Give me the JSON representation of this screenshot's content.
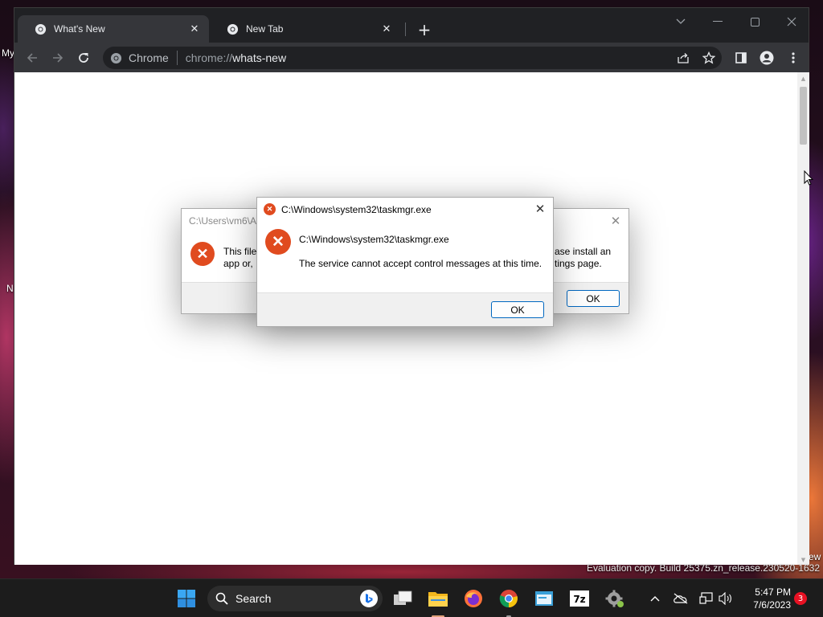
{
  "desktop": {
    "labels": [
      "My",
      "N",
      "ew"
    ]
  },
  "browser": {
    "tabs": [
      {
        "title": "What's New",
        "active": true
      },
      {
        "title": "New Tab",
        "active": false
      }
    ],
    "omnibox": {
      "chip": "Chrome",
      "scheme": "chrome://",
      "host": "whats-new"
    }
  },
  "dialog_back": {
    "title": "C:\\Users\\vm6\\A",
    "message_left": "This file",
    "message_left_2": "app or,",
    "message_right": "ase install an",
    "message_right_2": "tings page.",
    "ok_label": "OK"
  },
  "dialog_front": {
    "title": "C:\\Windows\\system32\\taskmgr.exe",
    "heading": "C:\\Windows\\system32\\taskmgr.exe",
    "message": "The service cannot accept control messages at this time.",
    "ok_label": "OK"
  },
  "taskbar": {
    "search_label": "Search",
    "time": "5:47 PM",
    "date": "7/6/2023",
    "notification_count": "3",
    "apps": [
      "start-icon",
      "search",
      "bing-icon",
      "task-view-icon",
      "file-explorer-icon",
      "firefox-icon",
      "chrome-icon",
      "app-icon",
      "7zip-icon",
      "settings-icon"
    ]
  },
  "watermark": "Evaluation copy. Build 25375.zn_release.230520-1632",
  "colors": {
    "error_red": "#e04b1f",
    "button_accent": "#0067c0",
    "browser_frame": "#202124",
    "browser_toolbar": "#35363a"
  }
}
